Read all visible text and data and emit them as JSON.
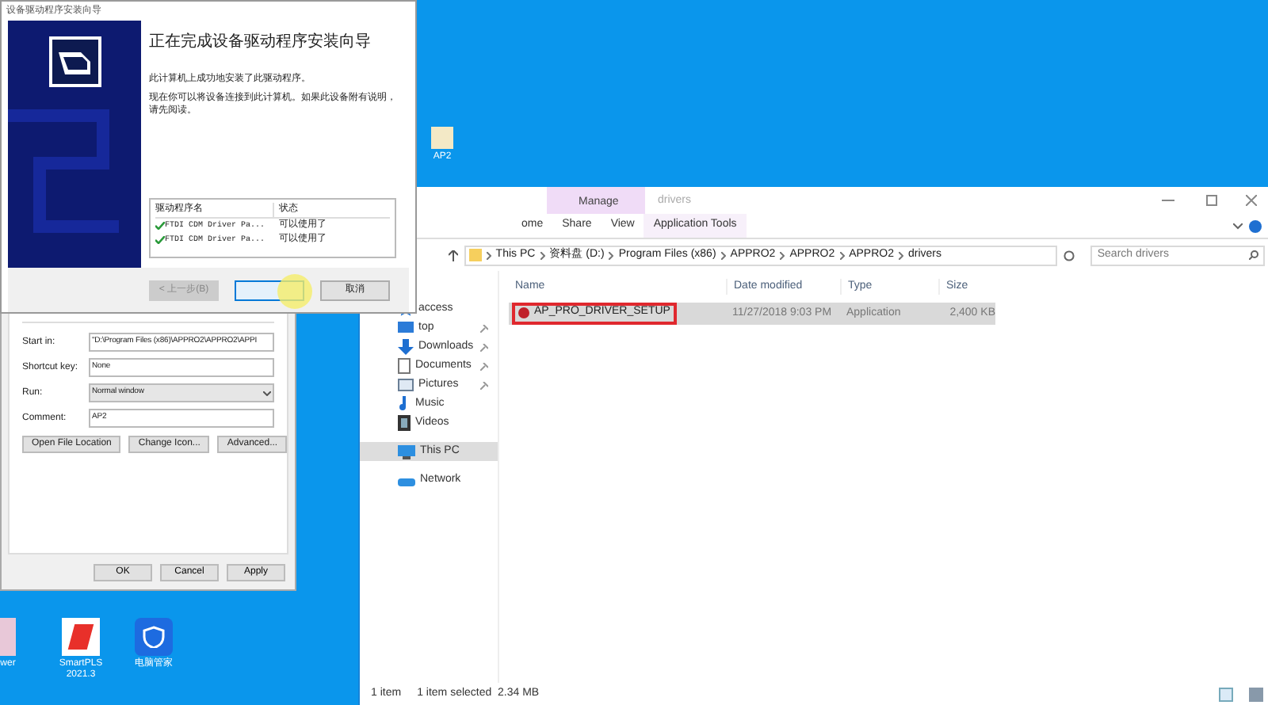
{
  "desktop": {
    "icons": [
      {
        "label": "AP2",
        "kind": "folder"
      }
    ],
    "bottom_icons": [
      {
        "label": "wer",
        "kind": "partial"
      },
      {
        "label": "SmartPLS 2021.3",
        "kind": "smartpls"
      },
      {
        "label": "电脑管家",
        "kind": "shield"
      }
    ]
  },
  "explorer": {
    "ribbon_tabs": [
      {
        "label": "ome",
        "selected": false
      },
      {
        "label": "Share",
        "selected": false
      },
      {
        "label": "View",
        "selected": false
      }
    ],
    "context_group": "Manage",
    "context_tab": "Application Tools",
    "title": "drivers",
    "breadcrumbs": [
      "This PC",
      "资料盘 (D:)",
      "Program Files (x86)",
      "APPRO2",
      "APPRO2",
      "APPRO2",
      "drivers"
    ],
    "search": {
      "placeholder": "Search drivers"
    },
    "nav": [
      {
        "label": "access",
        "kind": "star",
        "pinned": false,
        "selected": false
      },
      {
        "label": "top",
        "kind": "desktop",
        "pinned": true,
        "selected": false
      },
      {
        "label": "Downloads",
        "kind": "download",
        "pinned": true,
        "selected": false
      },
      {
        "label": "Documents",
        "kind": "document",
        "pinned": true,
        "selected": false
      },
      {
        "label": "Pictures",
        "kind": "picture",
        "pinned": true,
        "selected": false
      },
      {
        "label": "Music",
        "kind": "music",
        "pinned": false,
        "selected": false
      },
      {
        "label": "Videos",
        "kind": "video",
        "pinned": false,
        "selected": false
      },
      {
        "label": "This PC",
        "kind": "pc",
        "pinned": false,
        "selected": true
      },
      {
        "label": "Network",
        "kind": "network",
        "pinned": false,
        "selected": false
      }
    ],
    "columns": [
      "Name",
      "Date modified",
      "Type",
      "Size"
    ],
    "files": [
      {
        "name": "AP_PRO_DRIVER_SETUP",
        "date": "11/27/2018 9:03 PM",
        "type": "Application",
        "size": "2,400 KB",
        "selected": true
      }
    ],
    "status": [
      "1 item",
      "1 item selected  2.34 MB"
    ]
  },
  "properties": {
    "fields": [
      {
        "label": "Start in:",
        "value": "\"D:\\Program Files (x86)\\APPRO2\\APPRO2\\APPI",
        "kind": "text"
      },
      {
        "label": "Shortcut key:",
        "value": "None",
        "kind": "text"
      },
      {
        "label": "Run:",
        "value": "Normal window",
        "kind": "select"
      },
      {
        "label": "Comment:",
        "value": "AP2",
        "kind": "text"
      }
    ],
    "actions": [
      "Open File Location",
      "Change Icon...",
      "Advanced..."
    ],
    "buttons": [
      "OK",
      "Cancel",
      "Apply"
    ]
  },
  "wizard": {
    "title": "设备驱动程序安装向导",
    "heading": "正在完成设备驱动程序安装向导",
    "lines": [
      "此计算机上成功地安装了此驱动程序。",
      "现在你可以将设备连接到此计算机。如果此设备附有说明，请先阅读。"
    ],
    "columns": [
      "驱动程序名",
      "状态"
    ],
    "drivers": [
      {
        "name": "FTDI CDM Driver Pa...",
        "status": "可以使用了"
      },
      {
        "name": "FTDI CDM Driver Pa...",
        "status": "可以使用了"
      }
    ],
    "buttons": [
      {
        "label": "< 上一步(B)",
        "disabled": true
      },
      {
        "disabled": false
      },
      {
        "label": "取消",
        "disabled": false
      }
    ]
  }
}
